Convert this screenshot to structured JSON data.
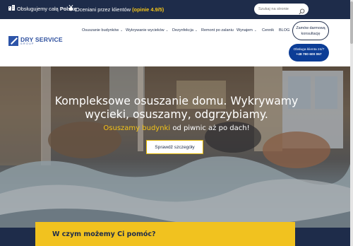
{
  "topbar": {
    "serve_prefix": "Obsługujemy całą",
    "serve_bold": "Polskę",
    "rating_text": "Oceniani przez klientów",
    "rating_value": "(opinie 4.9/5)",
    "search_placeholder": "Szukaj na stronie"
  },
  "logo": {
    "name": "DRY SERVICE",
    "sub": "GROUP"
  },
  "nav": {
    "items": [
      {
        "label": "Osuszanie budynków",
        "has_dropdown": true
      },
      {
        "label": "Wykrywanie wycieków",
        "has_dropdown": true
      },
      {
        "label": "Dezynfekcja",
        "has_dropdown": true
      },
      {
        "label": "Remont po zalaniu",
        "has_dropdown": false
      },
      {
        "label": "Wynajem",
        "has_dropdown": true
      },
      {
        "label": "Cennik",
        "has_dropdown": false
      },
      {
        "label": "BLOG",
        "has_dropdown": false
      }
    ],
    "dropdown_glyph": "⌄"
  },
  "cta": {
    "order_line1": "Zamów darmową",
    "order_line2": "konsultację",
    "support_line1": "Obsługa klienta 24/7",
    "support_phone": "+48 780 600 067"
  },
  "hero": {
    "title": "Kompleksowe osuszanie domu. Wykrywamy wycieki, osuszamy, odgrzybiamy.",
    "subtitle_highlight": "Osuszamy budynki",
    "subtitle_rest": "od piwnic aż po dach!",
    "button_label": "Sprawdź szczegóły"
  },
  "help": {
    "title": "W czym możemy Ci pomóc?"
  },
  "colors": {
    "navy": "#1e2c4a",
    "accent": "#f5c518",
    "blue": "#0c3d96",
    "help_bg": "#f1c21f"
  }
}
